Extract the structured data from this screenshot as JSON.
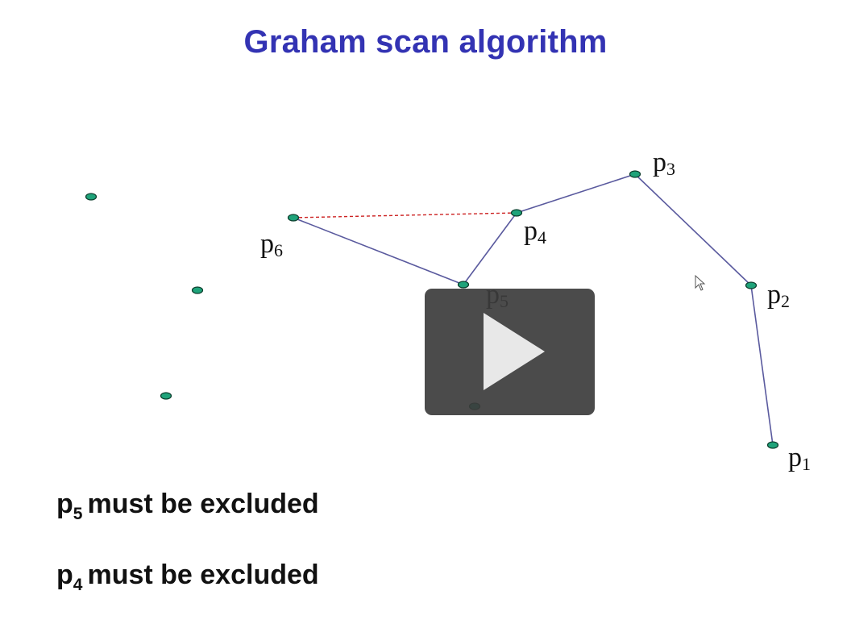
{
  "title": "Graham scan algorithm",
  "point_labels": [
    {
      "base": "p",
      "sub": "1"
    },
    {
      "base": "p",
      "sub": "2"
    },
    {
      "base": "p",
      "sub": "3"
    },
    {
      "base": "p",
      "sub": "4"
    },
    {
      "base": "p",
      "sub": "5"
    },
    {
      "base": "p",
      "sub": "6"
    }
  ],
  "notes": [
    {
      "base": "p",
      "sub": "5",
      "text": "must be excluded"
    },
    {
      "base": "p",
      "sub": "4",
      "text": "must be excluded"
    }
  ],
  "colors": {
    "title": "#3333b3",
    "hull_edge": "#5a5a9e",
    "test_edge": "#cc2222",
    "point_fill": "#1fa37a",
    "point_stroke": "#0b3d2c",
    "overlay": "#3c3c3c"
  },
  "icons": {
    "play": "play-icon",
    "cursor": "mouse-cursor-icon"
  }
}
